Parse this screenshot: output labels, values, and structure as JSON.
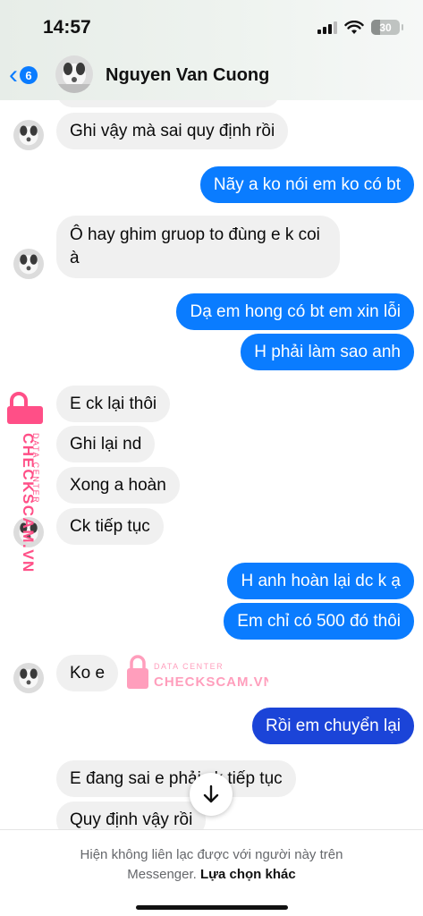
{
  "status_bar": {
    "time": "14:57",
    "battery": "30",
    "battery_level": 0.3
  },
  "header": {
    "back_badge": "6",
    "contact_name": "Nguyen Van Cuong"
  },
  "messages": [
    {
      "side": "in",
      "text": "Ghi vậy mà sai quy định rồi"
    },
    {
      "side": "out",
      "text": "Nãy a ko nói em ko có bt"
    },
    {
      "side": "in",
      "text": "Ô hay ghim gruop to đùng e k coi à"
    },
    {
      "side": "out",
      "text": "Dạ em hong có bt em xin lỗi"
    },
    {
      "side": "out",
      "text": "H phải làm sao anh"
    },
    {
      "side": "in",
      "text": "E ck lại thôi"
    },
    {
      "side": "in",
      "text": "Ghi lại nd"
    },
    {
      "side": "in",
      "text": "Xong a hoàn"
    },
    {
      "side": "in",
      "text": "Ck tiếp tục"
    },
    {
      "side": "out",
      "text": "H anh hoàn lại dc k ạ"
    },
    {
      "side": "out",
      "text": "Em chỉ có 500 đó thôi"
    },
    {
      "side": "in",
      "text": "Ko e"
    },
    {
      "side": "out",
      "text": "Rồi em chuyển lại"
    },
    {
      "side": "in",
      "text": "E đang sai e phải ck tiếp tục"
    },
    {
      "side": "in",
      "text": "Quy định vậy rồi"
    }
  ],
  "watermark": {
    "line1": "DATA CENTER",
    "line2": "CHECKSCAM.VN",
    "color": "#ff4f87"
  },
  "footer": {
    "notice": "Hiện không liên lạc được với người này trên Messenger.",
    "link": "Lựa chọn khác"
  },
  "colors": {
    "outgoing": "#0a7cff",
    "outgoing_dark": "#1b44d8",
    "incoming": "#f0f0f0"
  }
}
